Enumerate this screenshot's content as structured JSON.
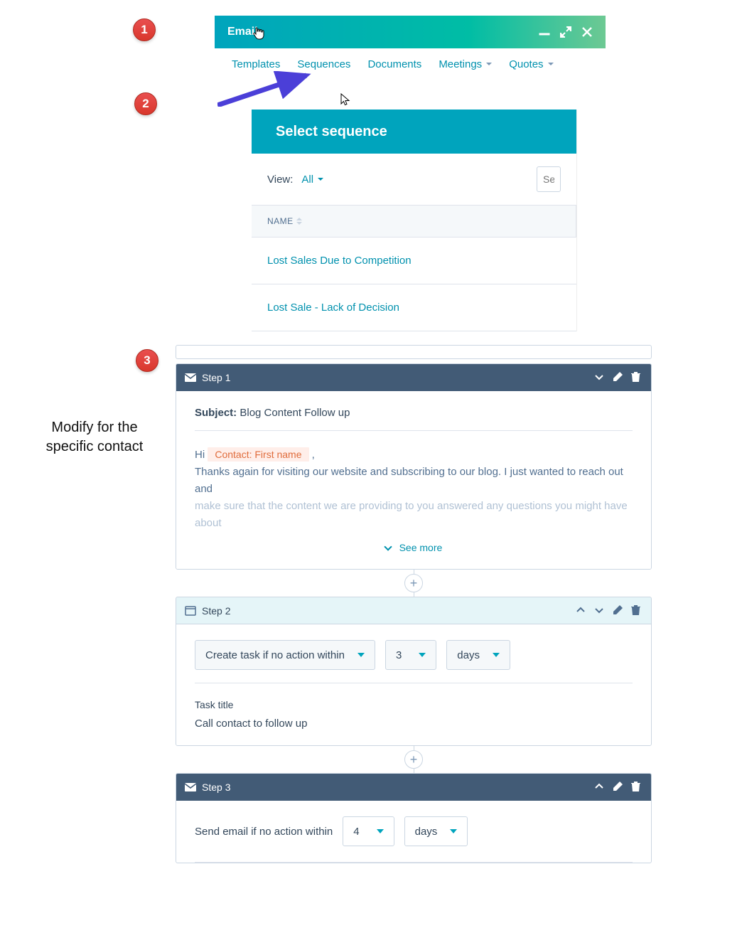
{
  "badges": {
    "one": "1",
    "two": "2",
    "three": "3"
  },
  "emailBar": {
    "title": "Email",
    "tabs": {
      "templates": "Templates",
      "sequences": "Sequences",
      "documents": "Documents",
      "meetings": "Meetings",
      "quotes": "Quotes"
    }
  },
  "seqPanel": {
    "header": "Select sequence",
    "viewLabel": "View:",
    "viewFilter": "All",
    "searchPlaceholder": "Se",
    "colName": "NAME",
    "rows": [
      "Lost Sales Due to Competition",
      "Lost Sale - Lack of Decision"
    ]
  },
  "note": "Modify for the specific contact",
  "step1": {
    "label": "Step 1",
    "subjectLabel": "Subject:",
    "subjectValue": "Blog Content Follow up",
    "greeting": "Hi",
    "token": "Contact: First name",
    "comma": ",",
    "body1": "Thanks again for visiting our website and subscribing to our blog.  I just wanted to reach out and",
    "body2": "make sure that the content we are providing to you answered any questions you might have about",
    "seeMore": "See more"
  },
  "plus": "+",
  "step2": {
    "label": "Step 2",
    "trigger": "Create task if no action within",
    "number": "3",
    "unit": "days",
    "taskTitleLabel": "Task title",
    "taskTitleValue": "Call contact to follow up"
  },
  "step3": {
    "label": "Step 3",
    "trigger": "Send email if no action within",
    "number": "4",
    "unit": "days"
  }
}
